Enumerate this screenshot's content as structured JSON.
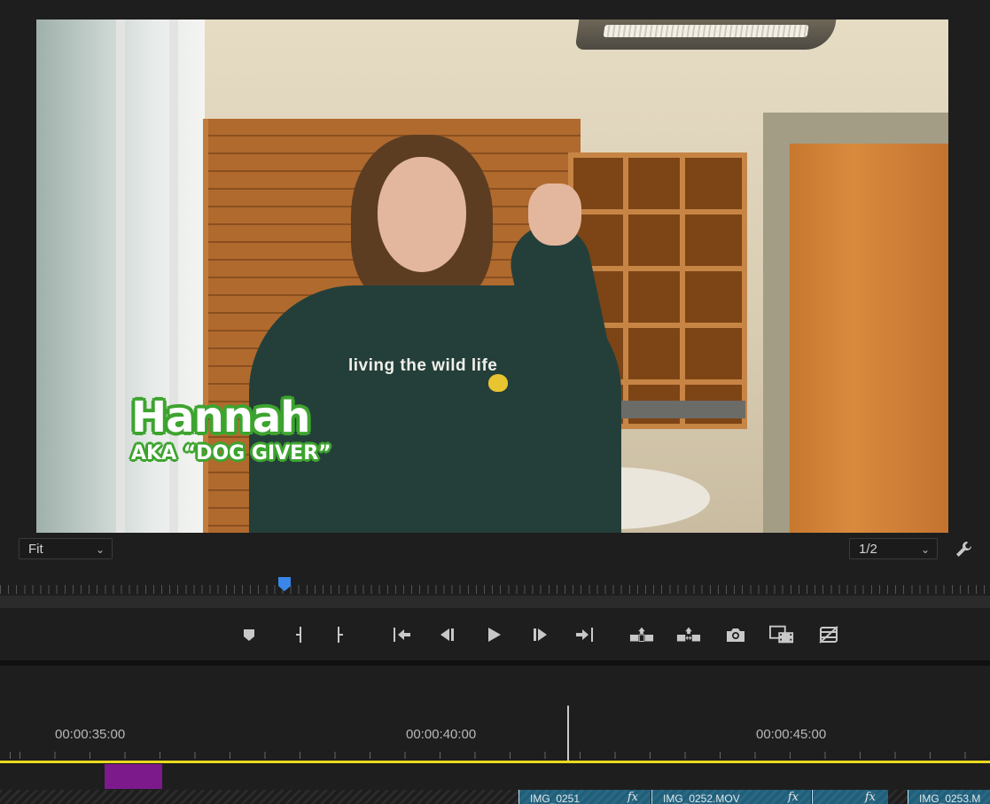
{
  "monitor": {
    "lower_third": {
      "name": "Hannah",
      "aka": "AKA “DOG GIVER”"
    },
    "shirt_print": "living the wild life",
    "zoom_select": "Fit",
    "resolution_select": "1/2",
    "settings_icon": "wrench-icon"
  },
  "transport": {
    "buttons": [
      {
        "name": "add-marker-button",
        "icon": "marker-icon"
      },
      {
        "name": "mark-in-button",
        "icon": "mark-in-icon"
      },
      {
        "name": "mark-out-button",
        "icon": "mark-out-icon"
      },
      {
        "name": "go-to-in-button",
        "icon": "go-to-in-icon"
      },
      {
        "name": "step-back-button",
        "icon": "step-back-icon"
      },
      {
        "name": "play-button",
        "icon": "play-icon"
      },
      {
        "name": "step-forward-button",
        "icon": "step-forward-icon"
      },
      {
        "name": "go-to-out-button",
        "icon": "go-to-out-icon"
      },
      {
        "name": "lift-button",
        "icon": "lift-icon"
      },
      {
        "name": "extract-button",
        "icon": "extract-icon"
      },
      {
        "name": "export-frame-button",
        "icon": "camera-icon"
      },
      {
        "name": "comparison-view-button",
        "icon": "comparison-icon"
      },
      {
        "name": "proxy-toggle-button",
        "icon": "proxy-icon"
      }
    ]
  },
  "timeline": {
    "timecodes": [
      "00:00:35:00",
      "00:00:40:00",
      "00:00:45:00"
    ],
    "clips": [
      {
        "label": "IMG_0251",
        "fx": "fx"
      },
      {
        "label": "IMG_0252.MOV",
        "fx": "fx"
      },
      {
        "label": "",
        "fx": "fx"
      },
      {
        "label": "IMG_0253.M",
        "fx": ""
      }
    ],
    "colors": {
      "work_area": "#e8da1e",
      "marker": "#7c1a8c",
      "clip": "#1f5f7a",
      "playhead": "#3a86e8"
    }
  }
}
